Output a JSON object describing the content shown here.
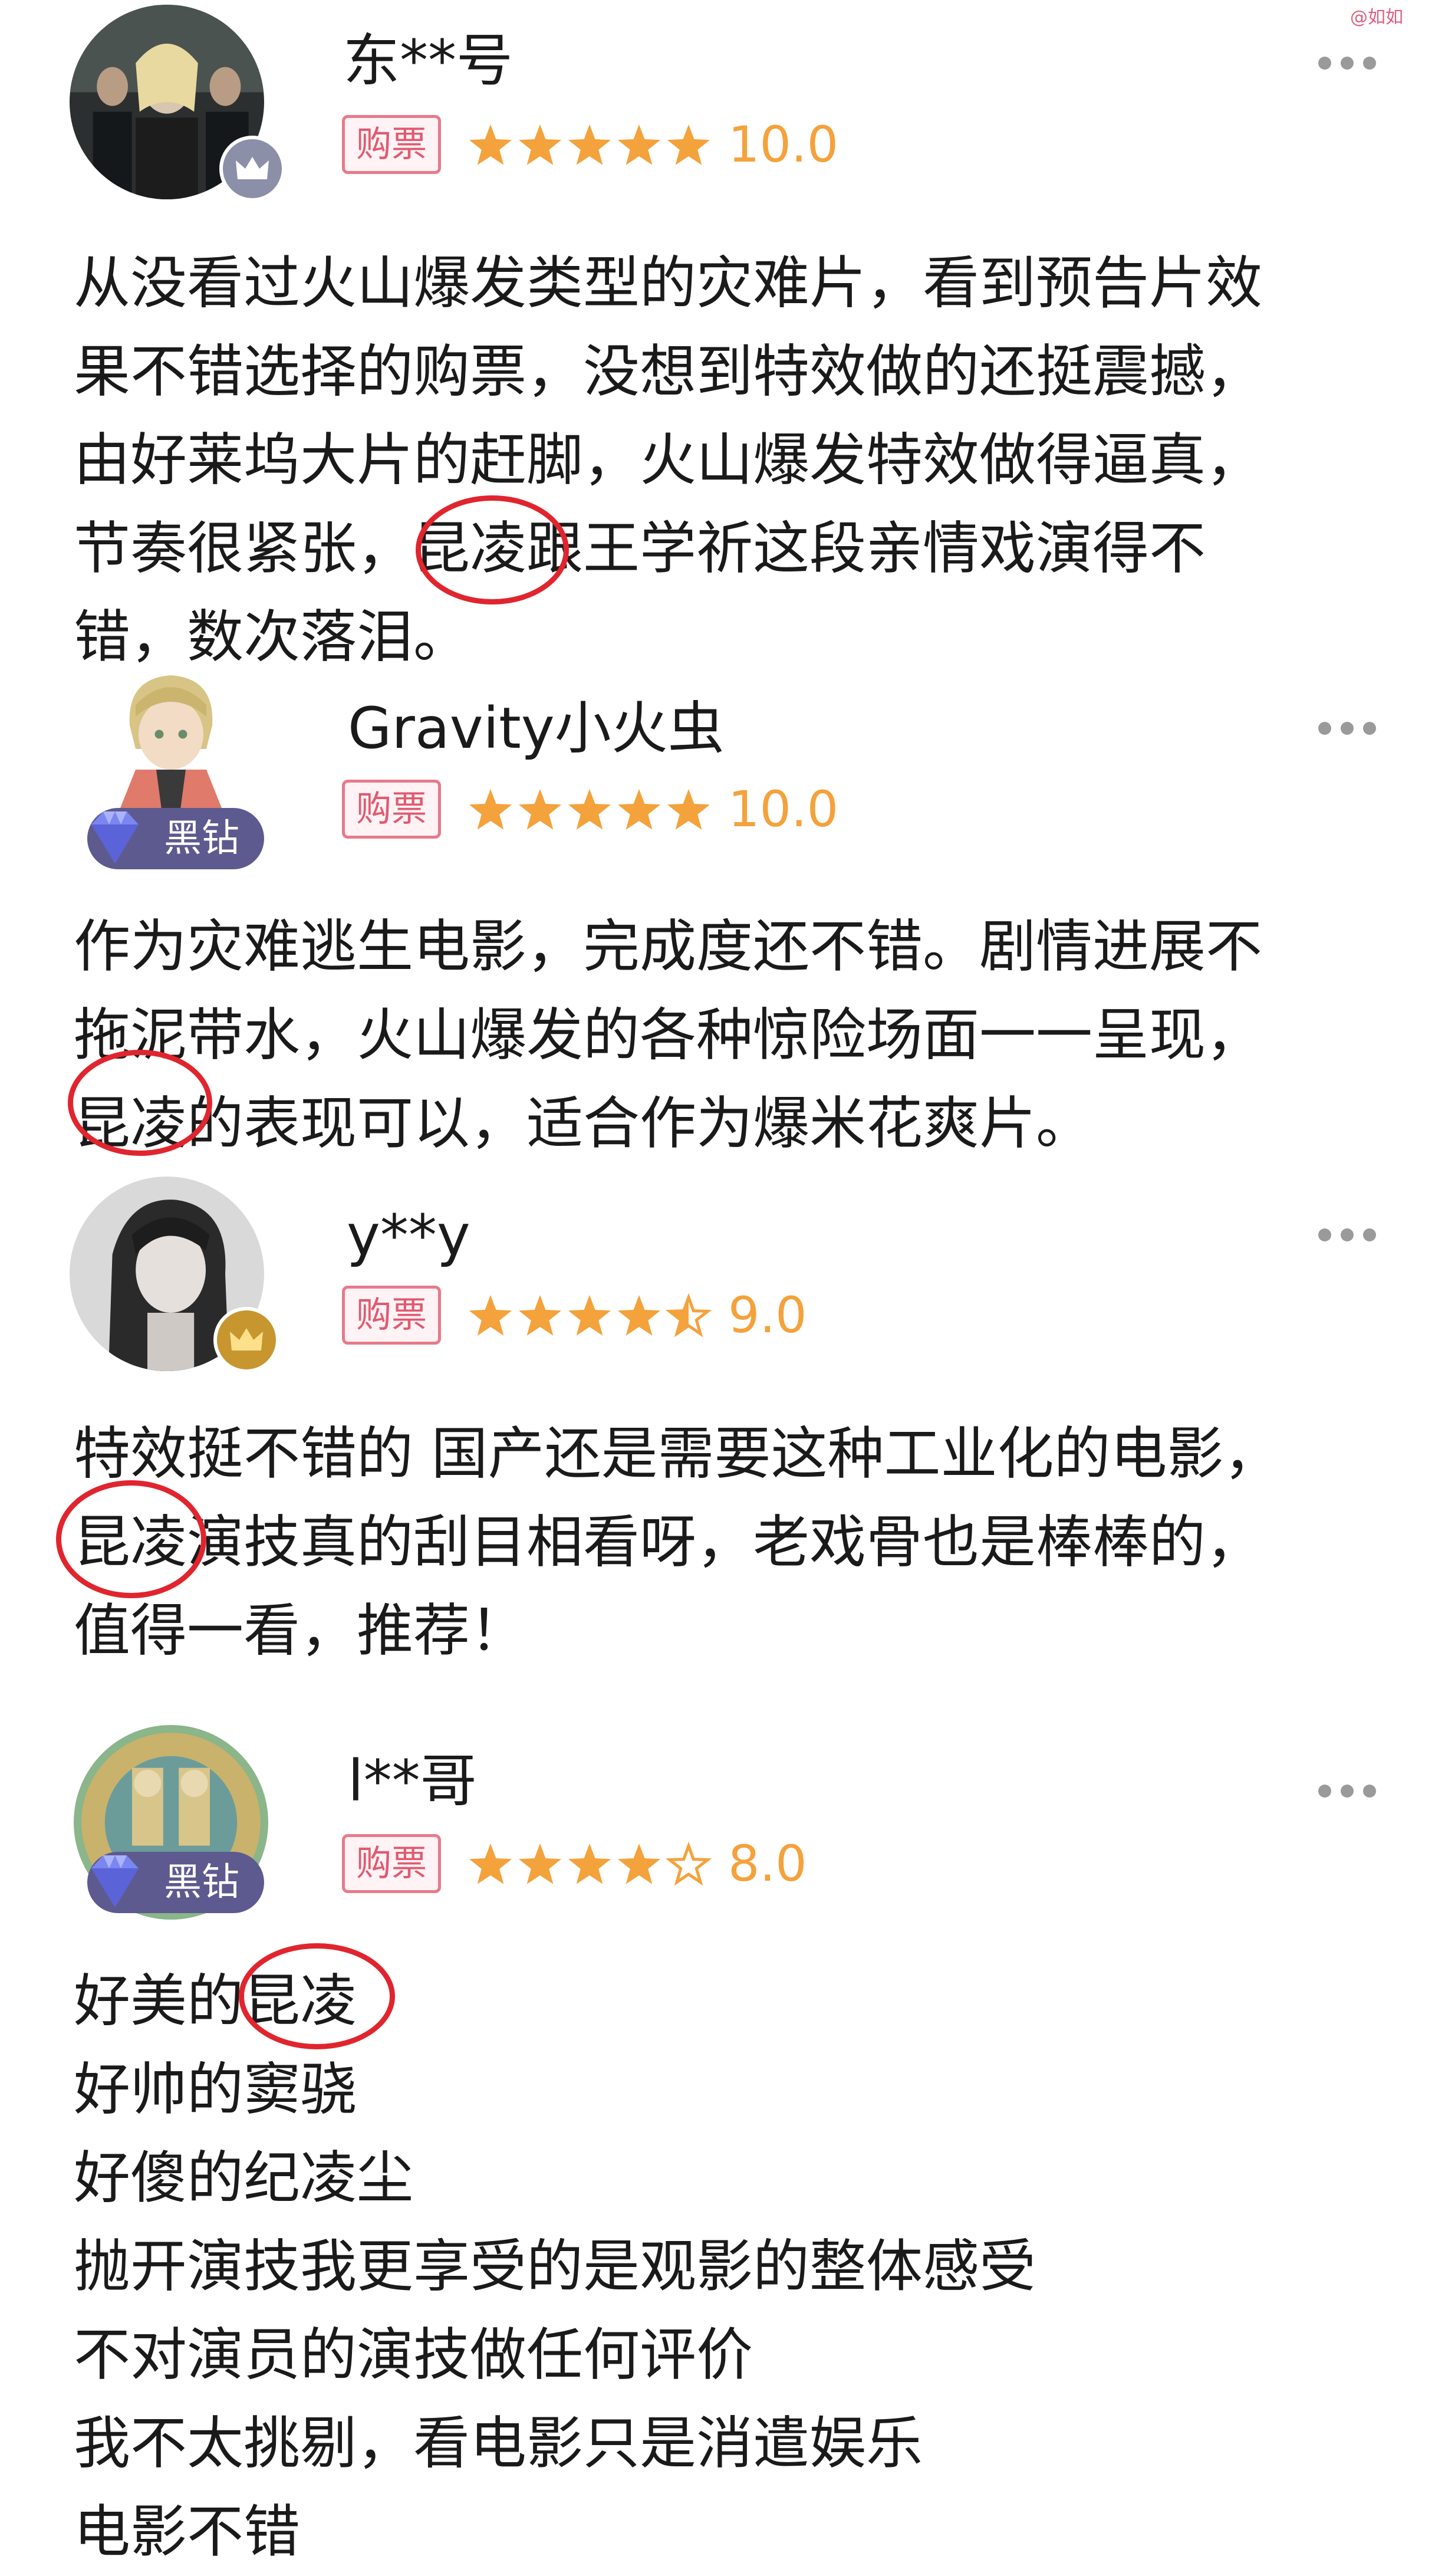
{
  "watermark": "@如如",
  "reviews": [
    {
      "username": "东**号",
      "tag": "购票",
      "score": "10.0",
      "stars": 5,
      "badge": "",
      "avatar_icon": "vip-crown-gray",
      "lines": [
        "从没看过火山爆发类型的灾难片，看到预告片效",
        "果不错选择的购票，没想到特效做的还挺震撼，",
        "由好莱坞大片的赶脚，火山爆发特效做得逼真，",
        "节奏很紧张，昆凌跟王学祈这段亲情戏演得不",
        "错，数次落泪。"
      ]
    },
    {
      "username": "Gravity小火虫",
      "tag": "购票",
      "score": "10.0",
      "stars": 5,
      "badge": "黑钻",
      "avatar_icon": "black-diamond",
      "lines": [
        "作为灾难逃生电影，完成度还不错。剧情进展不",
        "拖泥带水，火山爆发的各种惊险场面一一呈现，",
        "昆凌的表现可以，适合作为爆米花爽片。"
      ]
    },
    {
      "username": "y**y",
      "tag": "购票",
      "score": "9.0",
      "stars": 4.5,
      "badge": "",
      "avatar_icon": "vip-crown-gold",
      "lines": [
        "特效挺不错的 国产还是需要这种工业化的电影，",
        "昆凌演技真的刮目相看呀，老戏骨也是棒棒的，",
        "值得一看，推荐！"
      ]
    },
    {
      "username": "l**哥",
      "tag": "购票",
      "score": "8.0",
      "stars": 4,
      "badge": "黑钻",
      "avatar_icon": "black-diamond",
      "lines": [
        "好美的昆凌",
        "好帅的窦骁",
        "好傻的纪凌尘",
        "抛开演技我更享受的是观影的整体感受",
        "不对演员的演技做任何评价",
        "我不太挑剔，看电影只是消遣娱乐",
        "电影不错"
      ]
    }
  ],
  "colors": {
    "star": "#f4a23c",
    "tag_border": "#e87a8a",
    "tag_text": "#e05a70",
    "badge_bg": "#5d5a8f",
    "highlight_circle": "#e0252e"
  }
}
